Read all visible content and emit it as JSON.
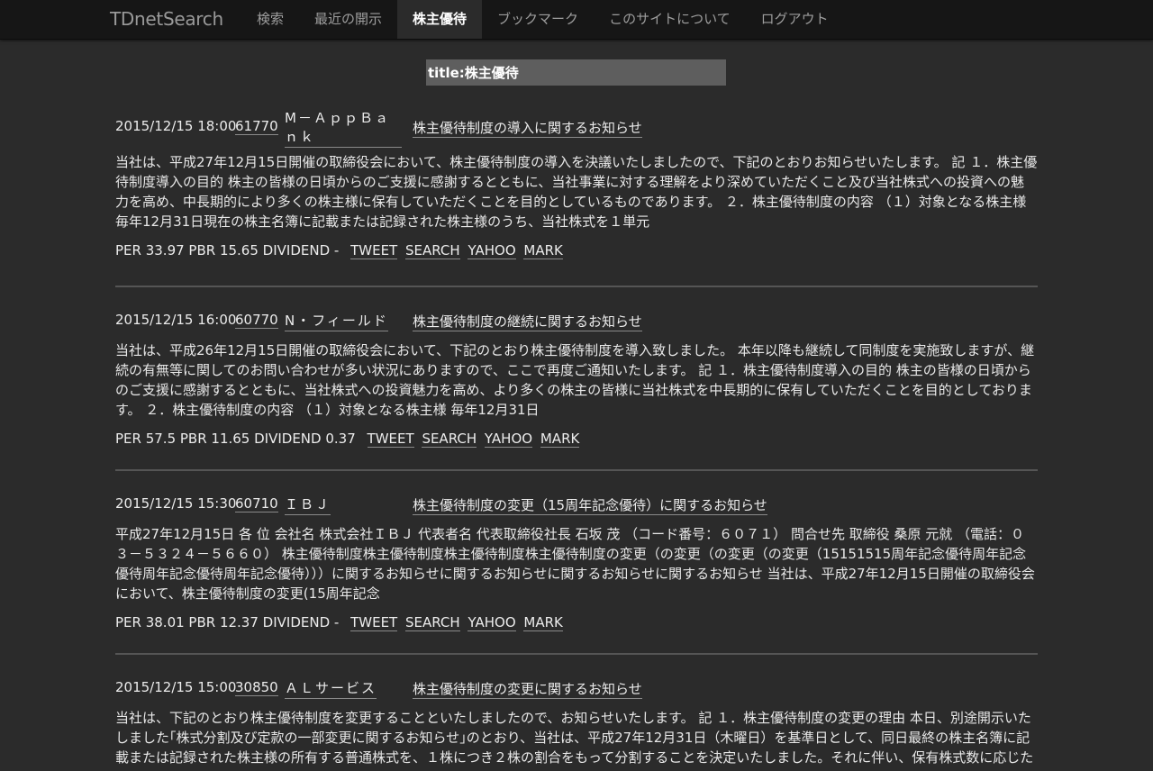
{
  "nav": {
    "brand": "TDnetSearch",
    "items": [
      "検索",
      "最近の開示",
      "株主優待",
      "ブックマーク",
      "このサイトについて",
      "ログアウト"
    ],
    "active_index": 2
  },
  "search": {
    "value": "title:株主優待"
  },
  "entries": [
    {
      "datetime": "2015/12/15 18:00",
      "code": "61770",
      "company": "M－ＡｐｐＢａｎｋ",
      "title": "株主優待制度の導入に関するお知らせ",
      "body": "当社は、平成27年12月15日開催の取締役会において、株主優待制度の導入を決議いたしましたので、下記のとおりお知らせいたします。 記 １．株主優待制度導入の目的 株主の皆様の日頃からのご支援に感謝するとともに、当社事業に対する理解をより深めていただくこと及び当社株式への投資への魅力を高め、中長期的により多くの株主様に保有していただくことを目的としているものであります。 ２．株主優待制度の内容 （１）対象となる株主様 毎年12月31日現在の株主名簿に記載または記録された株主様のうち、当社株式を１単元",
      "meta": "PER 33.97 PBR 15.65 DIVIDEND -"
    },
    {
      "datetime": "2015/12/15 16:00",
      "code": "60770",
      "company": "N・フィールド",
      "title": "株主優待制度の継続に関するお知らせ",
      "body": "当社は、平成26年12月15日開催の取締役会において、下記のとおり株主優待制度を導入致しました。 本年以降も継続して同制度を実施致しますが、継続の有無等に関してのお問い合わせが多い状況にありますので、ここで再度ご通知いたします。 記 １．株主優待制度導入の目的 株主の皆様の日頃からのご支援に感謝するとともに、当社株式への投資魅力を高め、より多くの株主の皆様に当社株式を中長期的に保有していただくことを目的としております。 ２．株主優待制度の内容 （１）対象となる株主様 毎年12月31日",
      "meta": "PER 57.5 PBR 11.65 DIVIDEND 0.37"
    },
    {
      "datetime": "2015/12/15 15:30",
      "code": "60710",
      "company": "ＩＢＪ",
      "title": "株主優待制度の変更（15周年記念優待）に関するお知らせ",
      "body": "平成27年12月15日 各 位 会社名 株式会社ＩＢＪ 代表者名 代表取締役社長 石坂 茂 （コード番号：６０７１） 問合せ先 取締役 桑原 元就 （電話：０３－５３２４－５６６０） 株主優待制度株主優待制度株主優待制度株主優待制度の変更（の変更（の変更（の変更（15151515周年記念優待周年記念優待周年記念優待周年記念優待）））に関するお知らせに関するお知らせに関するお知らせに関するお知らせ 当社は、平成27年12月15日開催の取締役会において、株主優待制度の変更(15周年記念",
      "meta": "PER 38.01 PBR 12.37 DIVIDEND -"
    },
    {
      "datetime": "2015/12/15 15:00",
      "code": "30850",
      "company": "ＡＬサービス",
      "title": "株主優待制度の変更に関するお知らせ",
      "body": "当社は、下記のとおり株主優待制度を変更することといたしましたので、お知らせいたします。 記 １．株主優待制度の変更の理由 本日、別途開示いたしました｢株式分割及び定款の一部変更に関するお知らせ｣のとおり、当社は、平成27年12月31日（木曜日）を基準日として、同日最終の株主名簿に記載または記録された株主様の所有する普通株式を、１株につき２株の割合をもって分割することを決定いたしました。それに伴い、保有株式数に応じた株主様への優待券の贈呈の基準を変更し、より多くの株主様に当社株式を保有",
      "meta": ""
    }
  ],
  "action_links": [
    "TWEET",
    "SEARCH",
    "YAHOO",
    "MARK"
  ]
}
